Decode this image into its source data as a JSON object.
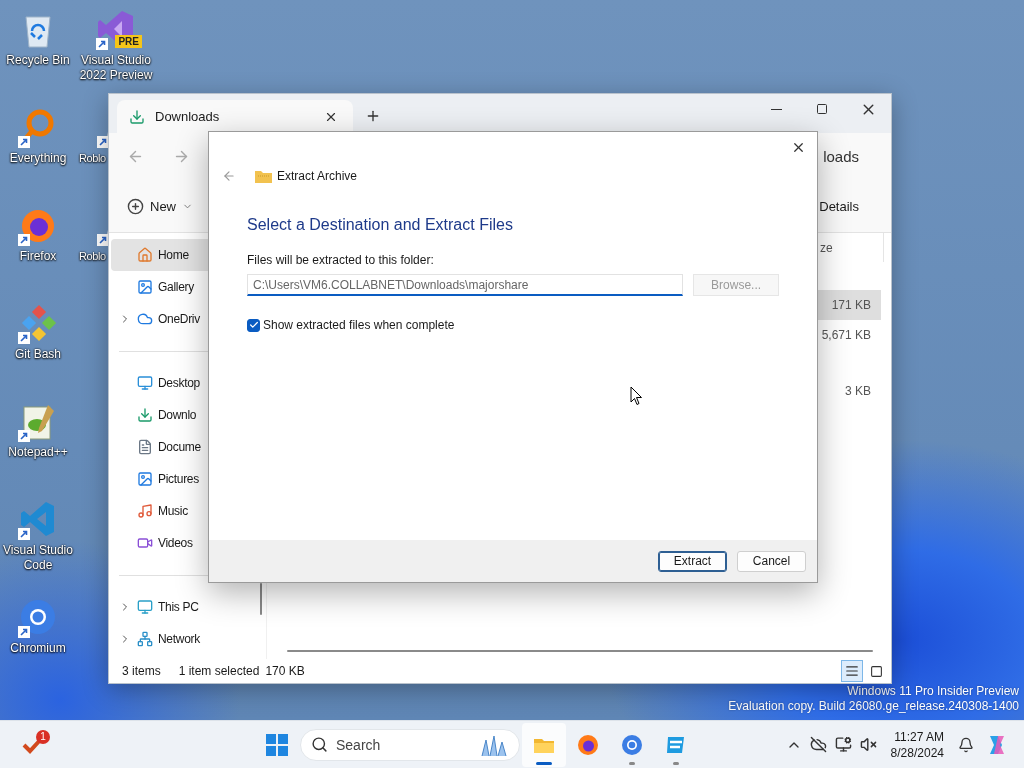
{
  "desktop": {
    "columns": [
      [
        {
          "label": "Recycle Bin",
          "shortcut": false,
          "covered": false
        },
        {
          "label": "Everything",
          "shortcut": true,
          "covered": false
        },
        {
          "label": "Firefox",
          "shortcut": true,
          "covered": false
        },
        {
          "label": "Git Bash",
          "shortcut": true,
          "covered": false
        },
        {
          "label": "Notepad++",
          "shortcut": true,
          "covered": false
        },
        {
          "label": "Visual Studio Code",
          "shortcut": true,
          "covered": false
        },
        {
          "label": "Chromium",
          "shortcut": true,
          "covered": false
        }
      ],
      [
        {
          "label": "Visual Studio 2022 Preview",
          "shortcut": true,
          "covered": false,
          "badge": "PRE"
        },
        {
          "label": "Roblo",
          "shortcut": true,
          "covered": true
        },
        {
          "label": "Roblo",
          "shortcut": true,
          "covered": true
        }
      ]
    ],
    "notice": [
      "Windows 11 Pro Insider Preview",
      "Evaluation copy. Build 26080.ge_release.240308-1400"
    ]
  },
  "explorer": {
    "tab": {
      "title": "Downloads",
      "selected": true
    },
    "address": "loads",
    "toolbar": {
      "new": "New",
      "details": "Details"
    },
    "sidebar": {
      "sections": [
        [
          {
            "label": "Home",
            "selected": true,
            "expandable": false
          },
          {
            "label": "Gallery",
            "selected": false,
            "expandable": false
          },
          {
            "label": "OneDriv",
            "selected": false,
            "expandable": true
          }
        ],
        [
          {
            "label": "Desktop",
            "selected": false,
            "expandable": false
          },
          {
            "label": "Downlo",
            "selected": false,
            "expandable": false
          },
          {
            "label": "Docume",
            "selected": false,
            "expandable": false
          },
          {
            "label": "Pictures",
            "selected": false,
            "expandable": false
          },
          {
            "label": "Music",
            "selected": false,
            "expandable": false
          },
          {
            "label": "Videos",
            "selected": false,
            "expandable": false
          }
        ],
        [
          {
            "label": "This PC",
            "selected": false,
            "expandable": true
          },
          {
            "label": "Network",
            "selected": false,
            "expandable": true
          }
        ]
      ]
    },
    "file_list": {
      "column_header": "ze",
      "groups": [
        {
          "rows": [
            {
              "size": "171 KB",
              "selected": true
            },
            {
              "size": "5,671 KB",
              "selected": false
            }
          ]
        },
        {
          "rows": [
            {
              "size": "3 KB",
              "selected": false
            }
          ]
        }
      ]
    },
    "status_bar": {
      "items": "3 items",
      "selection": "1 item selected",
      "size": "170 KB",
      "views": [
        {
          "selected": true
        },
        {
          "selected": false
        }
      ]
    }
  },
  "dialog": {
    "breadcrumb": "Extract Archive",
    "heading": "Select a Destination and Extract Files",
    "folder_label": "Files will be extracted to this folder:",
    "path": "C:\\Users\\VM6.COLLABNET\\Downloads\\majorshare",
    "browse": {
      "label": "Browse...",
      "disabled": true
    },
    "checkbox": {
      "label": "Show extracted files when complete",
      "checked": true
    },
    "buttons": [
      {
        "label": "Extract",
        "default": true
      },
      {
        "label": "Cancel",
        "default": false
      }
    ]
  },
  "taskbar": {
    "badge": "1",
    "search": {
      "label": "Search"
    },
    "apps": [
      {
        "active": true,
        "running": true
      },
      {
        "active": false,
        "running": false
      },
      {
        "active": false,
        "running": true
      },
      {
        "active": false,
        "running": true
      }
    ],
    "clock": {
      "time": "11:27 AM",
      "date": "8/28/2024"
    }
  }
}
